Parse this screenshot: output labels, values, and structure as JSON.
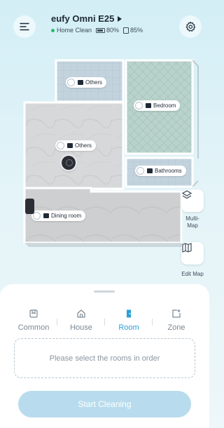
{
  "header": {
    "device_name": "eufy Omni E25",
    "mode": "Home Clean",
    "battery": "80%",
    "water": "85%"
  },
  "map": {
    "rooms": [
      {
        "id": "others-top",
        "label": "Others",
        "icon": "storage-icon"
      },
      {
        "id": "bedroom",
        "label": "Bedroom",
        "icon": "bed-icon"
      },
      {
        "id": "others-mid",
        "label": "Others",
        "icon": "storage-icon"
      },
      {
        "id": "bathrooms",
        "label": "Bathrooms",
        "icon": "bathtub-icon"
      },
      {
        "id": "dining-room",
        "label": "Dining room",
        "icon": "dining-icon"
      }
    ],
    "multi_map_label_1": "Multi-",
    "multi_map_label_2": "Map",
    "edit_map_label": "Edit Map"
  },
  "sheet": {
    "tabs": [
      {
        "label": "Common",
        "icon": "bookmark-icon",
        "active": false
      },
      {
        "label": "House",
        "icon": "house-icon",
        "active": false
      },
      {
        "label": "Room",
        "icon": "door-icon",
        "active": true
      },
      {
        "label": "Zone",
        "icon": "zone-add-icon",
        "active": false
      }
    ],
    "placeholder": "Please select the rooms in order",
    "start_label": "Start Cleaning"
  },
  "colors": {
    "accent": "#2a9fd6",
    "status_green": "#23c16b",
    "start_button": "#b8dced"
  }
}
